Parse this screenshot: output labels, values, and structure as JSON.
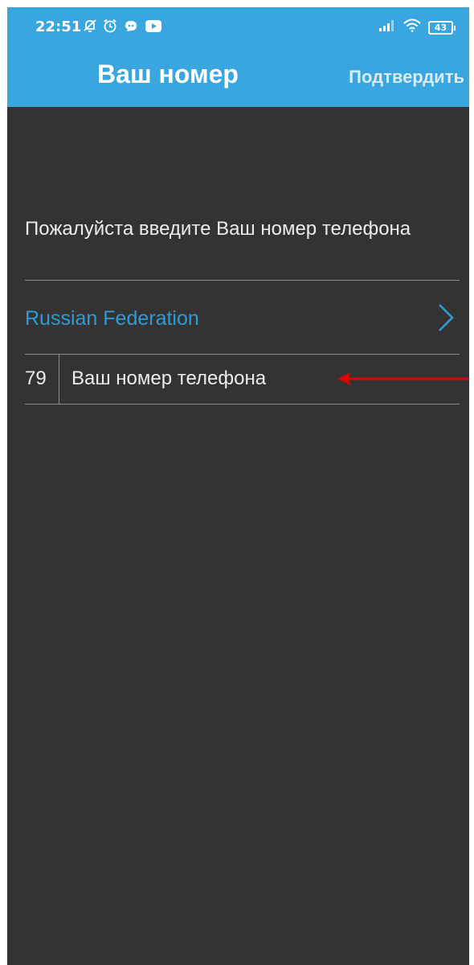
{
  "status_bar": {
    "time": "22:51",
    "battery": "43",
    "icons_left": [
      "notifications-off-icon",
      "alarm-icon",
      "chat-icon",
      "youtube-icon"
    ],
    "icons_right": [
      "signal-icon",
      "wifi-icon",
      "battery-icon"
    ]
  },
  "app_bar": {
    "title": "Ваш номер",
    "confirm_label": "Подтвердить",
    "color": "#3aa6df"
  },
  "form": {
    "prompt": "Пожалуйста введите Ваш номер телефона",
    "country": "Russian Federation",
    "country_color": "#2e9bd6",
    "phone_code": "79",
    "phone_placeholder": "Ваш номер телефона",
    "phone_value": ""
  },
  "annotation": {
    "arrow_color": "#e60000",
    "icon": "red-arrow-left-icon"
  }
}
